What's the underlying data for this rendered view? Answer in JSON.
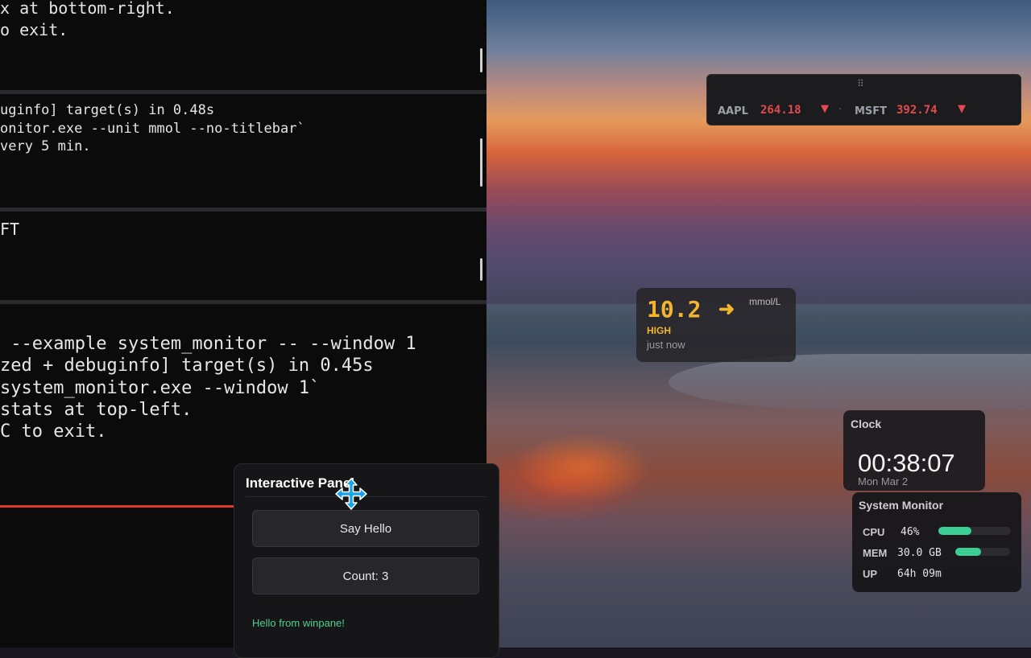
{
  "terminal": {
    "pane1": {
      "lines": [
        "x at bottom-right.",
        "o exit."
      ]
    },
    "pane2": {
      "lines": [
        "uginfo] target(s) in 0.48s",
        "onitor.exe --unit mmol --no-titlebar`",
        "very 5 min."
      ]
    },
    "pane3": {
      "lines": [
        "FT"
      ]
    },
    "pane4": {
      "lines": [
        " --example system_monitor -- --window 1",
        "zed + debuginfo] target(s) in 0.45s",
        "system_monitor.exe --window 1`",
        "stats at top-left.",
        "C to exit."
      ]
    }
  },
  "interactive_panel": {
    "title": "Interactive Panel",
    "say_hello_label": "Say Hello",
    "count_label": "Count: 3",
    "message": "Hello from winpane!"
  },
  "ticker": {
    "grip": "⠿",
    "items": [
      {
        "symbol": "AAPL",
        "price": "264.18",
        "direction": "▼"
      },
      {
        "symbol": "MSFT",
        "price": "392.74",
        "direction": "▼"
      }
    ],
    "separator": "·",
    "down_color": "#e3494f"
  },
  "glucose": {
    "value": "10.2",
    "trend": "➜",
    "unit": "mmol/L",
    "status": "HIGH",
    "updated": "just now",
    "color": "#f4b52c"
  },
  "clock": {
    "title": "Clock",
    "time": "00:38:07",
    "date": "Mon Mar 2"
  },
  "system_monitor": {
    "title": "System Monitor",
    "cpu": {
      "label": "CPU",
      "value": "46%",
      "level": 0.46
    },
    "mem": {
      "label": "MEM",
      "value": "30.0 GB",
      "level": 0.47
    },
    "up": {
      "label": "UP",
      "value": "64h 09m"
    },
    "bar_color": "#3ccf95"
  }
}
